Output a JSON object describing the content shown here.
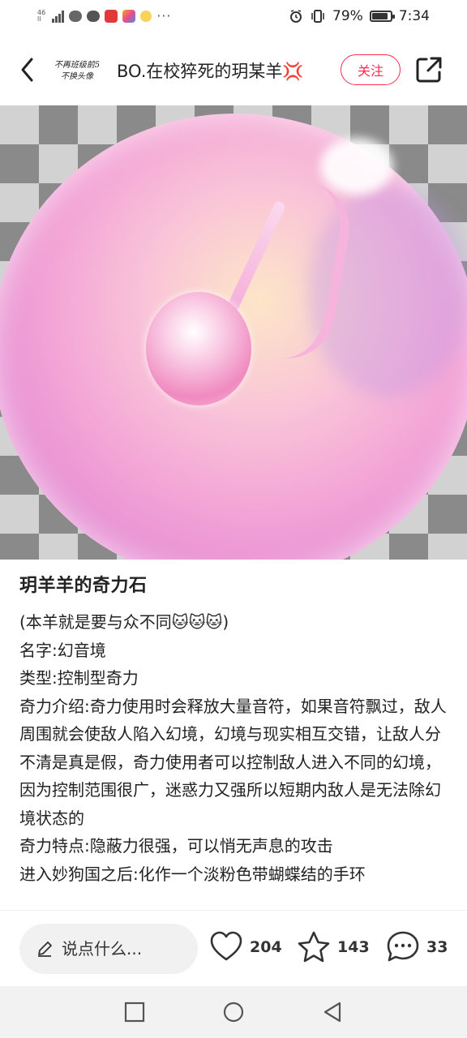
{
  "status_bar": {
    "network_top": "46",
    "network_bottom": "ll",
    "overflow": "···",
    "battery_percent": "79%",
    "battery_level": 0.79,
    "time": "7:34"
  },
  "header": {
    "avatar_line1": "不再班级前5",
    "avatar_line2": "不换头像",
    "author_name": "BO.在校猝死的玥某羊💢",
    "follow_label": "关注"
  },
  "post": {
    "title": "玥羊羊的奇力石",
    "lines": [
      "(本羊就是要与众不同🐱🐱🐱)",
      "名字:幻音境",
      "类型:控制型奇力",
      "奇力介绍:奇力使用时会释放大量音符，如果音符飘过，敌人周围就会使敌人陷入幻境，幻境与现实相互交错，让敌人分不清是真是假，奇力使用者可以控制敌人进入不同的幻境，因为控制范围很广，迷惑力又强所以短期内敌人是无法除幻境状态的",
      "奇力特点:隐蔽力很强，可以悄无声息的攻击",
      "进入妙狗国之后:化作一个淡粉色带蝴蝶结的手环"
    ]
  },
  "actions": {
    "comment_placeholder": "说点什么...",
    "likes": "204",
    "favorites": "143",
    "comments": "33"
  },
  "colors": {
    "accent": "#ff2a4f"
  }
}
